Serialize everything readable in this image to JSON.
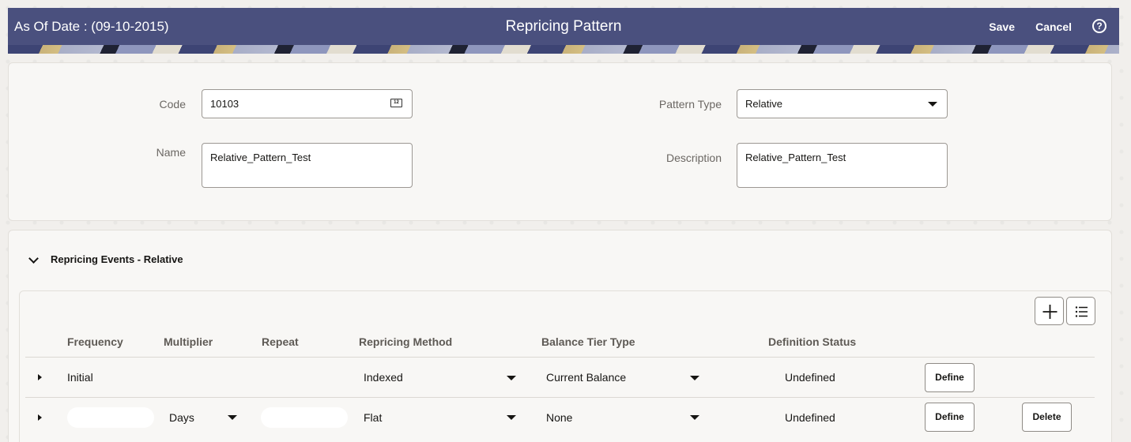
{
  "header": {
    "as_of": "As Of Date : (09-10-2015)",
    "title": "Repricing Pattern",
    "save_label": "Save",
    "cancel_label": "Cancel",
    "help_icon": "?"
  },
  "form": {
    "code_label": "Code",
    "code_value": "10103",
    "name_label": "Name",
    "name_value": "Relative_Pattern_Test",
    "pattern_type_label": "Pattern Type",
    "pattern_type_value": "Relative",
    "description_label": "Description",
    "description_value": "Relative_Pattern_Test"
  },
  "section": {
    "title": "Repricing Events -  Relative"
  },
  "table": {
    "columns": [
      "Frequency",
      "Multiplier",
      "Repeat",
      "Repricing Method",
      "Balance Tier Type",
      "Definition Status"
    ],
    "rows": [
      {
        "frequency": "Initial",
        "multiplier": "",
        "repeat": "",
        "repricing_method": "Indexed",
        "balance_tier_type": "Current Balance",
        "definition_status": "Undefined",
        "define_label": "Define"
      },
      {
        "frequency": "",
        "multiplier": "Days",
        "repeat": "",
        "repricing_method": "Flat",
        "balance_tier_type": "None",
        "definition_status": "Undefined",
        "define_label": "Define",
        "delete_label": "Delete"
      }
    ]
  },
  "calendar_icon_text": "12"
}
